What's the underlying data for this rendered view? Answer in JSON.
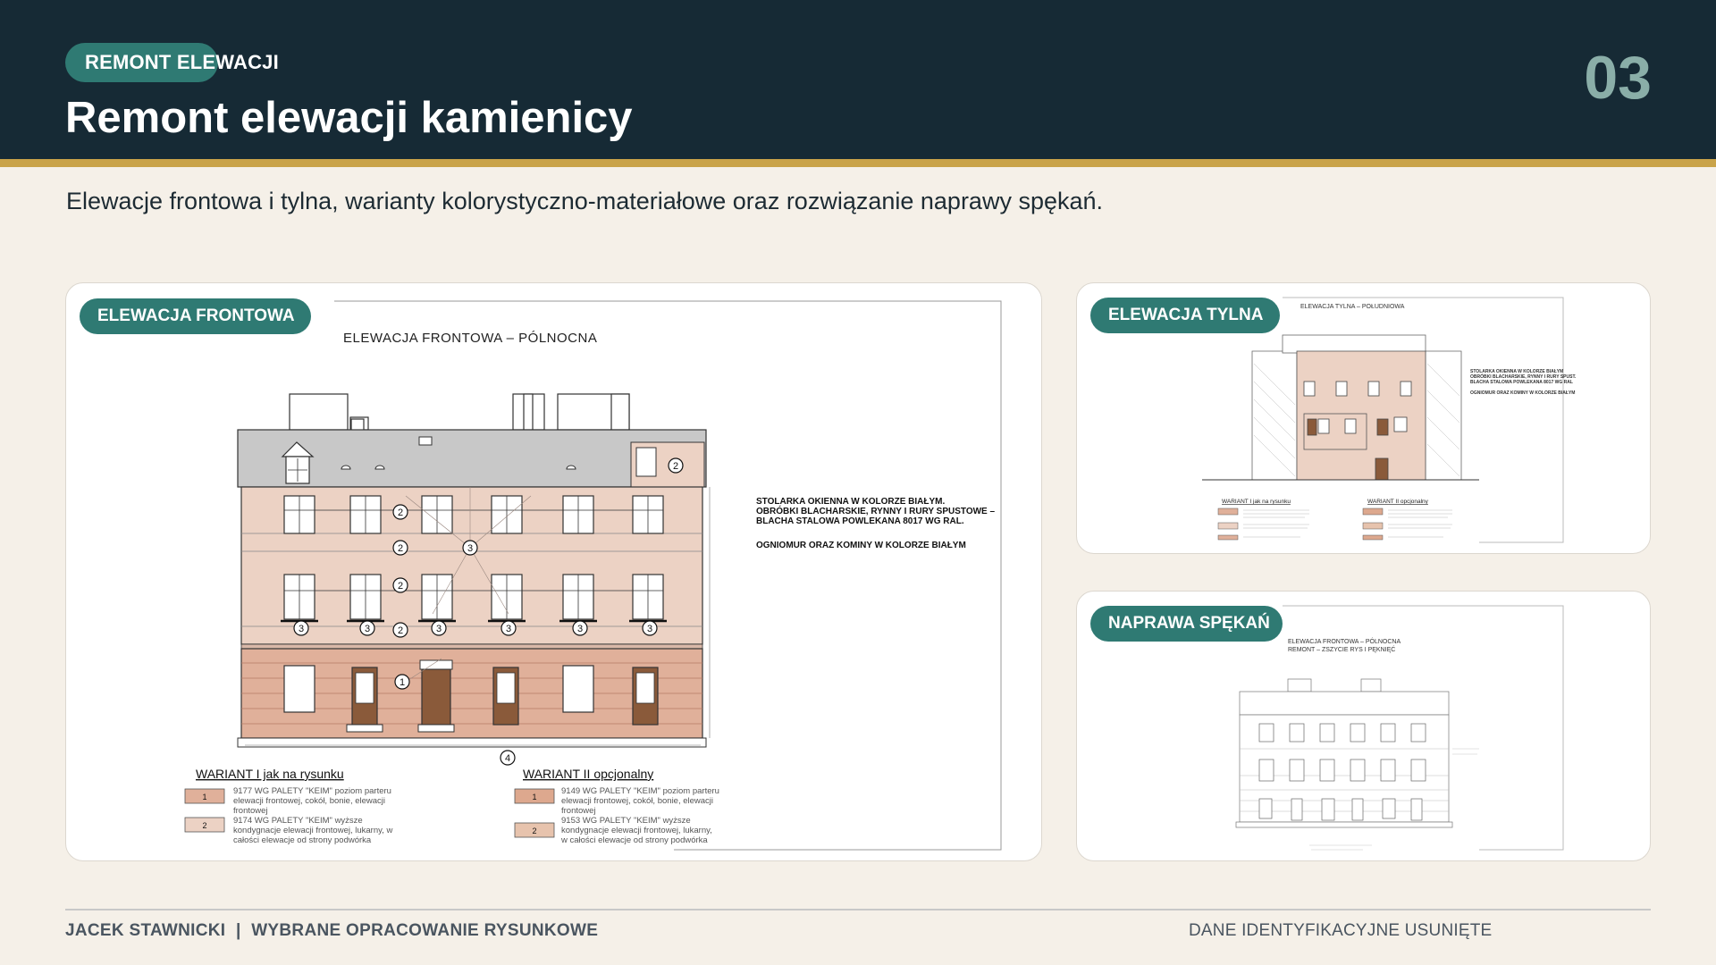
{
  "header": {
    "badge": "REMONT ELEWACJI",
    "title": "Remont elewacji kamienicy",
    "page_number": "03"
  },
  "subtitle": "Elewacje frontowa i tylna, warianty kolorystyczno-materiałowe oraz rozwiązanie naprawy spękań.",
  "cards": {
    "front": {
      "label": "ELEWACJA FRONTOWA",
      "drawing_title": "ELEWACJA FRONTOWA – PÓLNOCNA",
      "notes": [
        "STOLARKA OKIENNA W KOLORZE BIAŁYM.",
        "OBRÓBKI BLACHARSKIE, RYNNY I RURY SPUSTOWE –",
        "BLACHA STALOWA POWLEKANA 8017 WG RAL.",
        "OGNIOMUR ORAZ KOMINY W KOLORZE BIAŁYM"
      ],
      "markers": [
        "1",
        "2",
        "3",
        "4"
      ],
      "variant1": {
        "title": "WARIANT I jak na rysunku",
        "items": [
          {
            "num": "1",
            "color": "#e0b09a",
            "lines": [
              "9177 WG PALETY \"KEIM\" poziom parteru",
              "elewacji frontowej, cokół, bonie, elewacji",
              "frontowej"
            ]
          },
          {
            "num": "2",
            "color": "#ecd2c4",
            "lines": [
              "9174 WG PALETY \"KEIM\" wyższe",
              "kondygnacje elewacji frontowej, lukarny, w",
              "całości elewacje od strony podwórka"
            ]
          }
        ]
      },
      "variant2": {
        "title": "WARIANT II opcjonalny",
        "items": [
          {
            "num": "1",
            "color": "#dda88e",
            "lines": [
              "9149 WG PALETY \"KEIM\" poziom parteru",
              "elewacji frontowej, cokół, bonie, elewacji",
              "frontowej"
            ]
          },
          {
            "num": "2",
            "color": "#e7c3ad",
            "lines": [
              "9153 WG PALETY \"KEIM\" wyższe",
              "kondygnacje elewacji frontowej, lukarny,",
              "w całości elewacje od strony podwórka"
            ]
          }
        ]
      }
    },
    "rear": {
      "label": "ELEWACJA TYLNA",
      "drawing_title": "ELEWACJA TYLNA – POŁUDNIOWA",
      "notes": [
        "STOLARKA OKIENNA W KOLORZE BIAŁYM",
        "OBRÓBKI BLACHARSKIE, RYNNY I RURY SPUST.",
        "BLACHA STALOWA POWLEKANA 8017 WG RAL",
        "OGNIOMUR ORAZ KOMINY W KOLORZE BIAŁYM"
      ],
      "variant1_title": "WARIANT I jak na rysunku",
      "variant2_title": "WARIANT II opcjonalny"
    },
    "crack": {
      "label": "NAPRAWA SPĘKAŃ",
      "drawing_title_1": "ELEWACJA FRONTOWA – PÓLNOCNA",
      "drawing_title_2": "REMONT – ZSZYCIE RYS I PĘKNIĘĆ"
    }
  },
  "footer": {
    "author": "JACEK STAWNICKI",
    "separator": "|",
    "section": "WYBRANE OPRACOWANIE RYSUNKOWE",
    "note": "DANE IDENTYFIKACYJNE USUNIĘTE"
  },
  "colors": {
    "header_bg": "#162a35",
    "accent_gold": "#c9a349",
    "badge_teal": "#2f7a73",
    "page_number": "#8aaea8",
    "facade_upper": "#ecd2c4",
    "facade_ground": "#e0b09a",
    "roof": "#c8c8c8"
  }
}
